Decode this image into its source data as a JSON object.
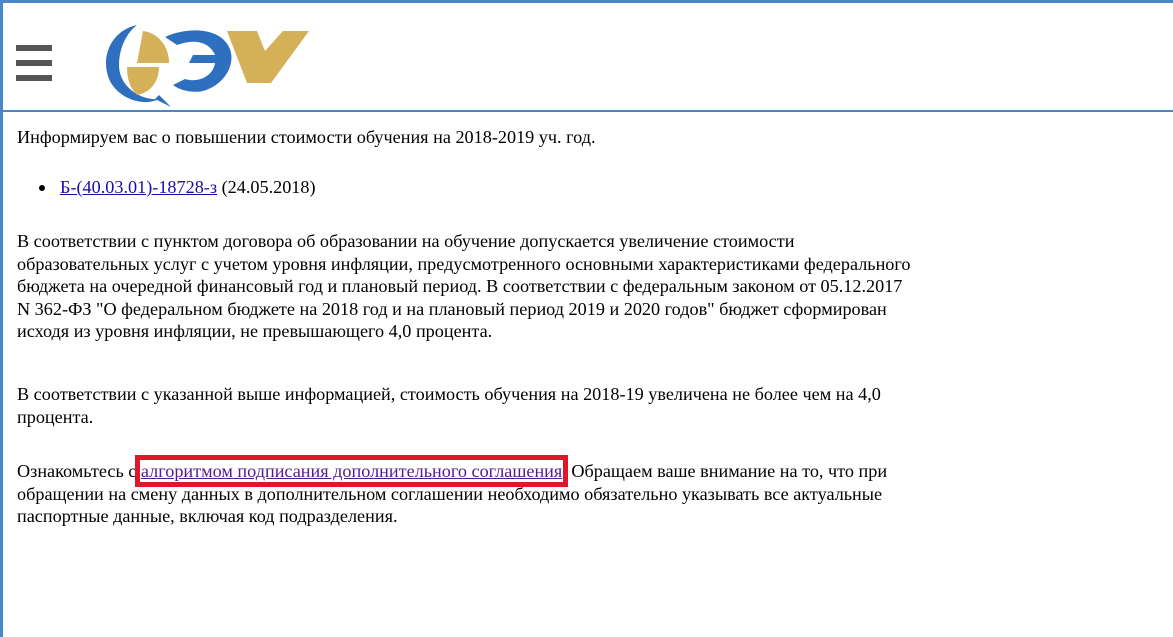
{
  "header": {
    "menu_icon": "hamburger-menu-icon",
    "logo": "university-logo"
  },
  "intro_text": "Информируем вас о повышении стоимости обучения на 2018-2019 уч. год.",
  "document": {
    "link_text": "Б-(40.03.01)-18728-з",
    "date_text": "(24.05.2018)"
  },
  "paragraph1": {
    "lines": [
      "В соответствии с пунктом договора об образовании на обучение допускается увеличение стоимости",
      "образовательных услуг с учетом уровня инфляции, предусмотренного основными характеристиками федерального",
      "бюджета на очередной финансовый год и плановый период. В соответствии с федеральным законом от 05.12.2017",
      "N 362-ФЗ \"О федеральном бюджете на 2018 год и на плановый период 2019 и 2020 годов\" бюджет сформирован",
      "исходя из уровня инфляции, не превышающего 4,0 процента."
    ]
  },
  "paragraph2": {
    "lines": [
      "В соответствии с указанной выше информацией, стоимость обучения на 2018-19 увеличена не более чем на 4,0",
      "процента."
    ]
  },
  "paragraph3": {
    "prefix": "Ознакомьтесь с ",
    "link_text": "алгоритмом подписания дополнительного соглашения",
    "suffix": ". Обращаем ваше внимание на то, что при",
    "lines": [
      "обращении на смену данных в дополнительном соглашении необходимо обязательно указывать все актуальные",
      "паспортные данные, включая код подразделения."
    ]
  },
  "colors": {
    "frame_border": "#4a86c8",
    "highlight": "#e0162b",
    "link": "#1a0dab",
    "visited_link": "#551a8b",
    "logo_blue": "#2f6fc0",
    "logo_gold": "#d4b058"
  }
}
